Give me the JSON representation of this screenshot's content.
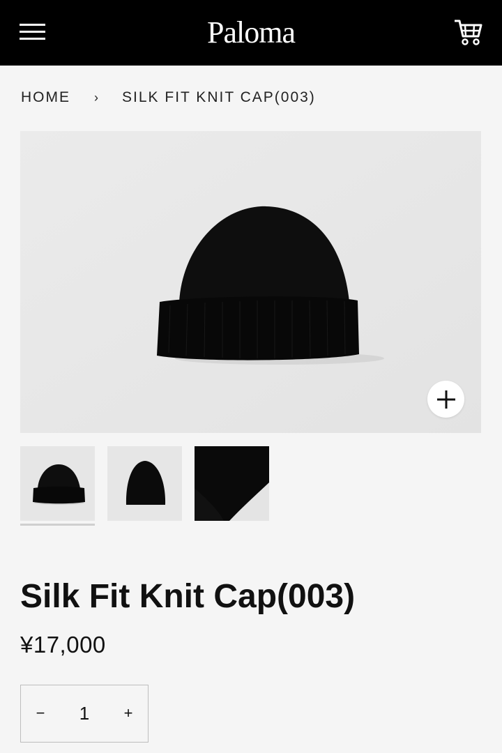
{
  "header": {
    "logo": "Paloma",
    "menu_icon": "hamburger-menu-icon",
    "cart_icon": "shopping-cart-icon",
    "background": "#000000",
    "foreground": "#ffffff"
  },
  "breadcrumb": {
    "home": "HOME",
    "separator": "›",
    "current": "SILK FIT KNIT CAP(003)"
  },
  "gallery": {
    "zoom_icon": "plus-zoom-icon",
    "thumbnails": [
      "thumbnail-front",
      "thumbnail-side",
      "thumbnail-closeup"
    ],
    "selected_index": 0
  },
  "product": {
    "title": "Silk Fit Knit Cap(003)",
    "price": "¥17,000"
  },
  "quantity": {
    "minus": "−",
    "value": "1",
    "plus": "+"
  }
}
